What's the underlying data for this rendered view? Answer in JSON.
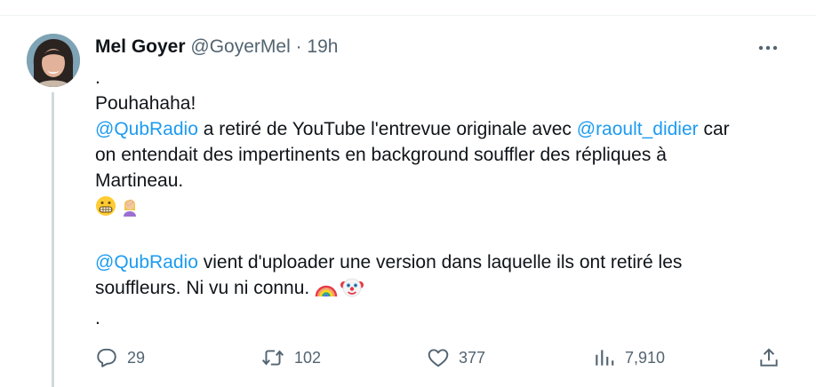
{
  "tweet": {
    "author_name": "Mel Goyer",
    "handle": "@GoyerMel",
    "separator": "·",
    "time": "19h",
    "lines": {
      "l1": ".",
      "l2": "Pouhahaha!",
      "l3_mention1": "@QubRadio",
      "l3_text1": " a retiré de YouTube l'entrevue originale avec ",
      "l3_mention2": "@raoult_didier",
      "l3_text2": " car",
      "l4": "on entendait des impertinents en background souffler des répliques à",
      "l5": "Martineau.",
      "l7_mention": "@QubRadio",
      "l7_text": " vient d'uploader une version dans laquelle ils ont retiré les",
      "l8": "souffleurs. Ni vu ni connu. ",
      "l9": "."
    },
    "emojis": [
      "grimacing-face",
      "woman-facepalming",
      "rainbow",
      "clown-face"
    ]
  },
  "actions": {
    "replies": "29",
    "retweets": "102",
    "likes": "377",
    "views": "7,910"
  },
  "colors": {
    "accent": "#1d9bf0",
    "text": "#0f1419",
    "muted": "#536471",
    "thread": "#cfd9de"
  }
}
